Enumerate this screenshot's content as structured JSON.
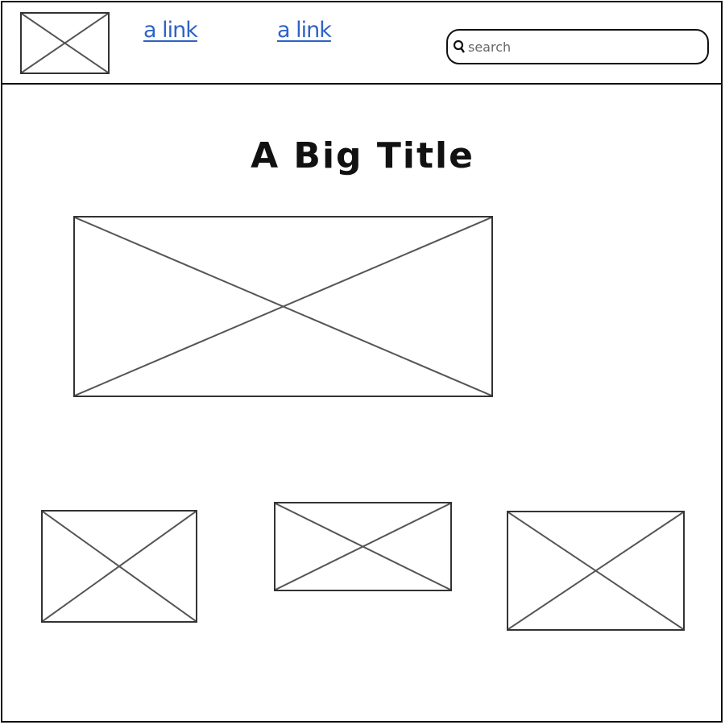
{
  "header": {
    "links": [
      {
        "label": "a link"
      },
      {
        "label": "a link"
      }
    ],
    "search": {
      "placeholder": "search",
      "icon": "search-icon"
    }
  },
  "main": {
    "title": "A Big Title"
  },
  "colors": {
    "link": "#2f63c4",
    "border": "#111111",
    "placeholder_cross": "#555555"
  }
}
